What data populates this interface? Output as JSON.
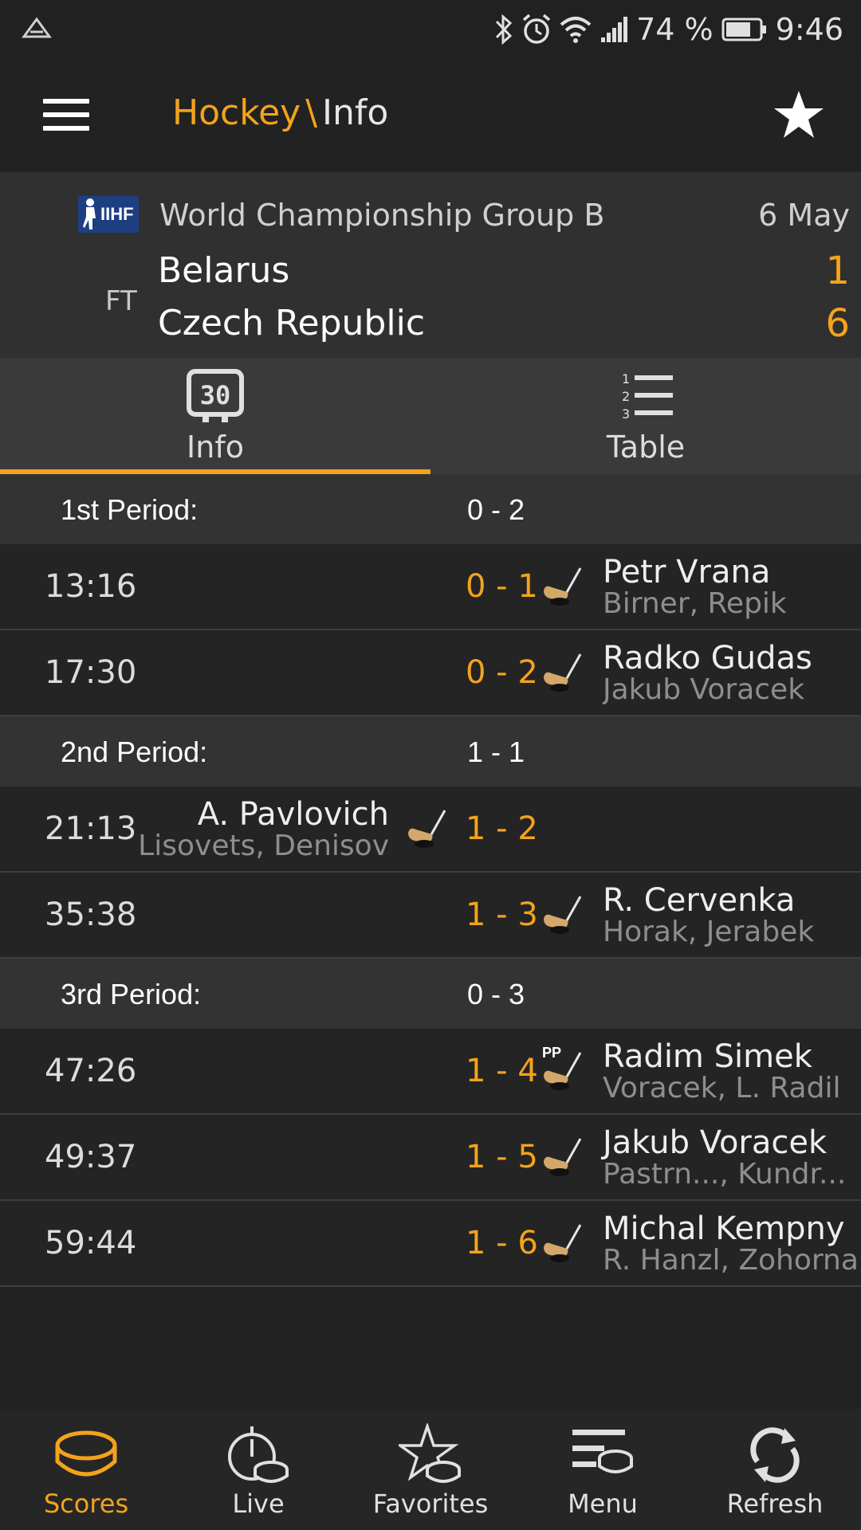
{
  "status_bar": {
    "battery": "74 %",
    "time": "9:46"
  },
  "header": {
    "section": "Hockey",
    "separator": "\\",
    "page": "Info"
  },
  "match": {
    "competition": "World Championship Group B",
    "date": "6 May",
    "status": "FT",
    "home_team": "Belarus",
    "away_team": "Czech Republic",
    "home_score": "1",
    "away_score": "6",
    "league_logo_text": "IIHF"
  },
  "tabs": [
    {
      "label": "Info",
      "icon": "scoreboard-icon",
      "active": true
    },
    {
      "label": "Table",
      "icon": "ranked-list-icon",
      "active": false
    }
  ],
  "periods": [
    {
      "label": "1st Period:",
      "score": "0 - 2",
      "goals": [
        {
          "time": "13:16",
          "score": "0 - 1",
          "scorer": "Petr Vrana",
          "assists": "Birner, Repik",
          "side": "away",
          "tag": ""
        },
        {
          "time": "17:30",
          "score": "0 - 2",
          "scorer": "Radko Gudas",
          "assists": "Jakub Voracek",
          "side": "away",
          "tag": ""
        }
      ]
    },
    {
      "label": "2nd Period:",
      "score": "1 - 1",
      "goals": [
        {
          "time": "21:13",
          "score": "1 - 2",
          "scorer": "A. Pavlovich",
          "assists": "Lisovets, Denisov",
          "side": "home",
          "tag": ""
        },
        {
          "time": "35:38",
          "score": "1 - 3",
          "scorer": "R. Cervenka",
          "assists": "Horak, Jerabek",
          "side": "away",
          "tag": ""
        }
      ]
    },
    {
      "label": "3rd Period:",
      "score": "0 - 3",
      "goals": [
        {
          "time": "47:26",
          "score": "1 - 4",
          "scorer": "Radim Simek",
          "assists": "Voracek, L. Radil",
          "side": "away",
          "tag": "PP"
        },
        {
          "time": "49:37",
          "score": "1 - 5",
          "scorer": "Jakub Voracek",
          "assists": "Pastrn..., Kundr...",
          "side": "away",
          "tag": ""
        },
        {
          "time": "59:44",
          "score": "1 - 6",
          "scorer": "Michal Kempny",
          "assists": "R. Hanzl, Zohorna",
          "side": "away",
          "tag": ""
        }
      ]
    }
  ],
  "bottom_nav": [
    {
      "label": "Scores",
      "icon": "puck-icon",
      "active": true
    },
    {
      "label": "Live",
      "icon": "stopwatch-puck-icon",
      "active": false
    },
    {
      "label": "Favorites",
      "icon": "star-puck-icon",
      "active": false
    },
    {
      "label": "Menu",
      "icon": "menu-puck-icon",
      "active": false
    },
    {
      "label": "Refresh",
      "icon": "refresh-icon",
      "active": false
    }
  ],
  "colors": {
    "accent": "#f4a31c",
    "background": "#222222",
    "header_bg": "#303030",
    "period_bg": "#333333"
  }
}
